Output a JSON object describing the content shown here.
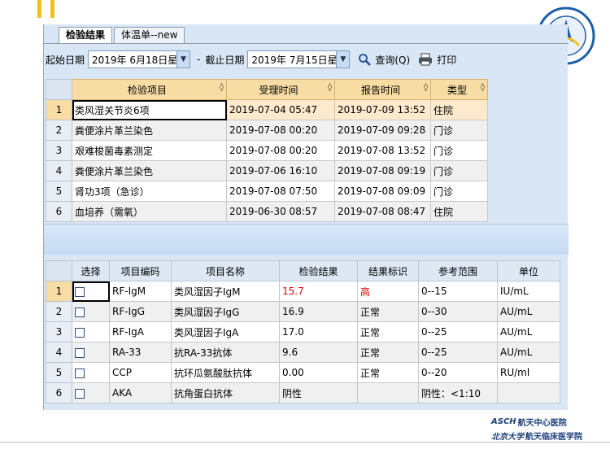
{
  "tabs": [
    {
      "label": "检验结果",
      "active": true
    },
    {
      "label": "体温单--new",
      "active": false
    }
  ],
  "toolbar": {
    "start_label": "起始日期",
    "start_value": "2019年  6月18日星",
    "end_label": "截止日期",
    "end_value": "2019年  7月15日星",
    "separator": "-",
    "query_label": "查询(Q)",
    "print_label": "打印"
  },
  "upper_grid": {
    "columns": [
      "检验项目",
      "受理时间",
      "报告时间",
      "类型"
    ],
    "rows": [
      {
        "n": "1",
        "item": "类风湿关节炎6项",
        "accept": "2019-07-04 05:47",
        "report": "2019-07-09 13:52",
        "type": "住院"
      },
      {
        "n": "2",
        "item": "粪便涂片革兰染色",
        "accept": "2019-07-08 00:20",
        "report": "2019-07-09 09:28",
        "type": "门诊"
      },
      {
        "n": "3",
        "item": "艰难梭菌毒素测定",
        "accept": "2019-07-08 00:20",
        "report": "2019-07-08 13:52",
        "type": "门诊"
      },
      {
        "n": "4",
        "item": "粪便涂片革兰染色",
        "accept": "2019-07-06 16:10",
        "report": "2019-07-08 09:19",
        "type": "门诊"
      },
      {
        "n": "5",
        "item": "肾功3项（急诊）",
        "accept": "2019-07-08 07:50",
        "report": "2019-07-08 09:09",
        "type": "门诊"
      },
      {
        "n": "6",
        "item": "血培养（需氧）",
        "accept": "2019-06-30 08:57",
        "report": "2019-07-08 08:47",
        "type": "住院"
      }
    ]
  },
  "lower_grid": {
    "columns": [
      "选择",
      "项目编码",
      "项目名称",
      "检验结果",
      "结果标识",
      "参考范围",
      "单位"
    ],
    "rows": [
      {
        "n": "1",
        "code": "RF-IgM",
        "name": "类风湿因子IgM",
        "result": "15.7",
        "flag": "高",
        "range": "0--15",
        "unit": "IU/mL"
      },
      {
        "n": "2",
        "code": "RF-IgG",
        "name": "类风湿因子IgG",
        "result": "16.9",
        "flag": "正常",
        "range": "0--30",
        "unit": "AU/mL"
      },
      {
        "n": "3",
        "code": "RF-IgA",
        "name": "类风湿因子IgA",
        "result": "17.0",
        "flag": "正常",
        "range": "0--25",
        "unit": "AU/mL"
      },
      {
        "n": "4",
        "code": "RA-33",
        "name": "抗RA-33抗体",
        "result": "9.6",
        "flag": "正常",
        "range": "0--25",
        "unit": "AU/mL"
      },
      {
        "n": "5",
        "code": "CCP",
        "name": "抗环瓜氨酸肽抗体",
        "result": "0.00",
        "flag": "正常",
        "range": "0--20",
        "unit": "RU/ml"
      },
      {
        "n": "6",
        "code": "AKA",
        "name": "抗角蛋白抗体",
        "result": "阴性",
        "flag": "",
        "range": "阴性：<1:10",
        "unit": ""
      }
    ]
  },
  "footer": {
    "line1_brand": "ASCH",
    "line1_text": "航天中心医院",
    "line2_script": "北京大学",
    "line2_text": "航天临床医学院"
  },
  "colors": {
    "accent": "#f0c020",
    "header_orange": "#f7dca4",
    "flag_high": "#e00000"
  }
}
